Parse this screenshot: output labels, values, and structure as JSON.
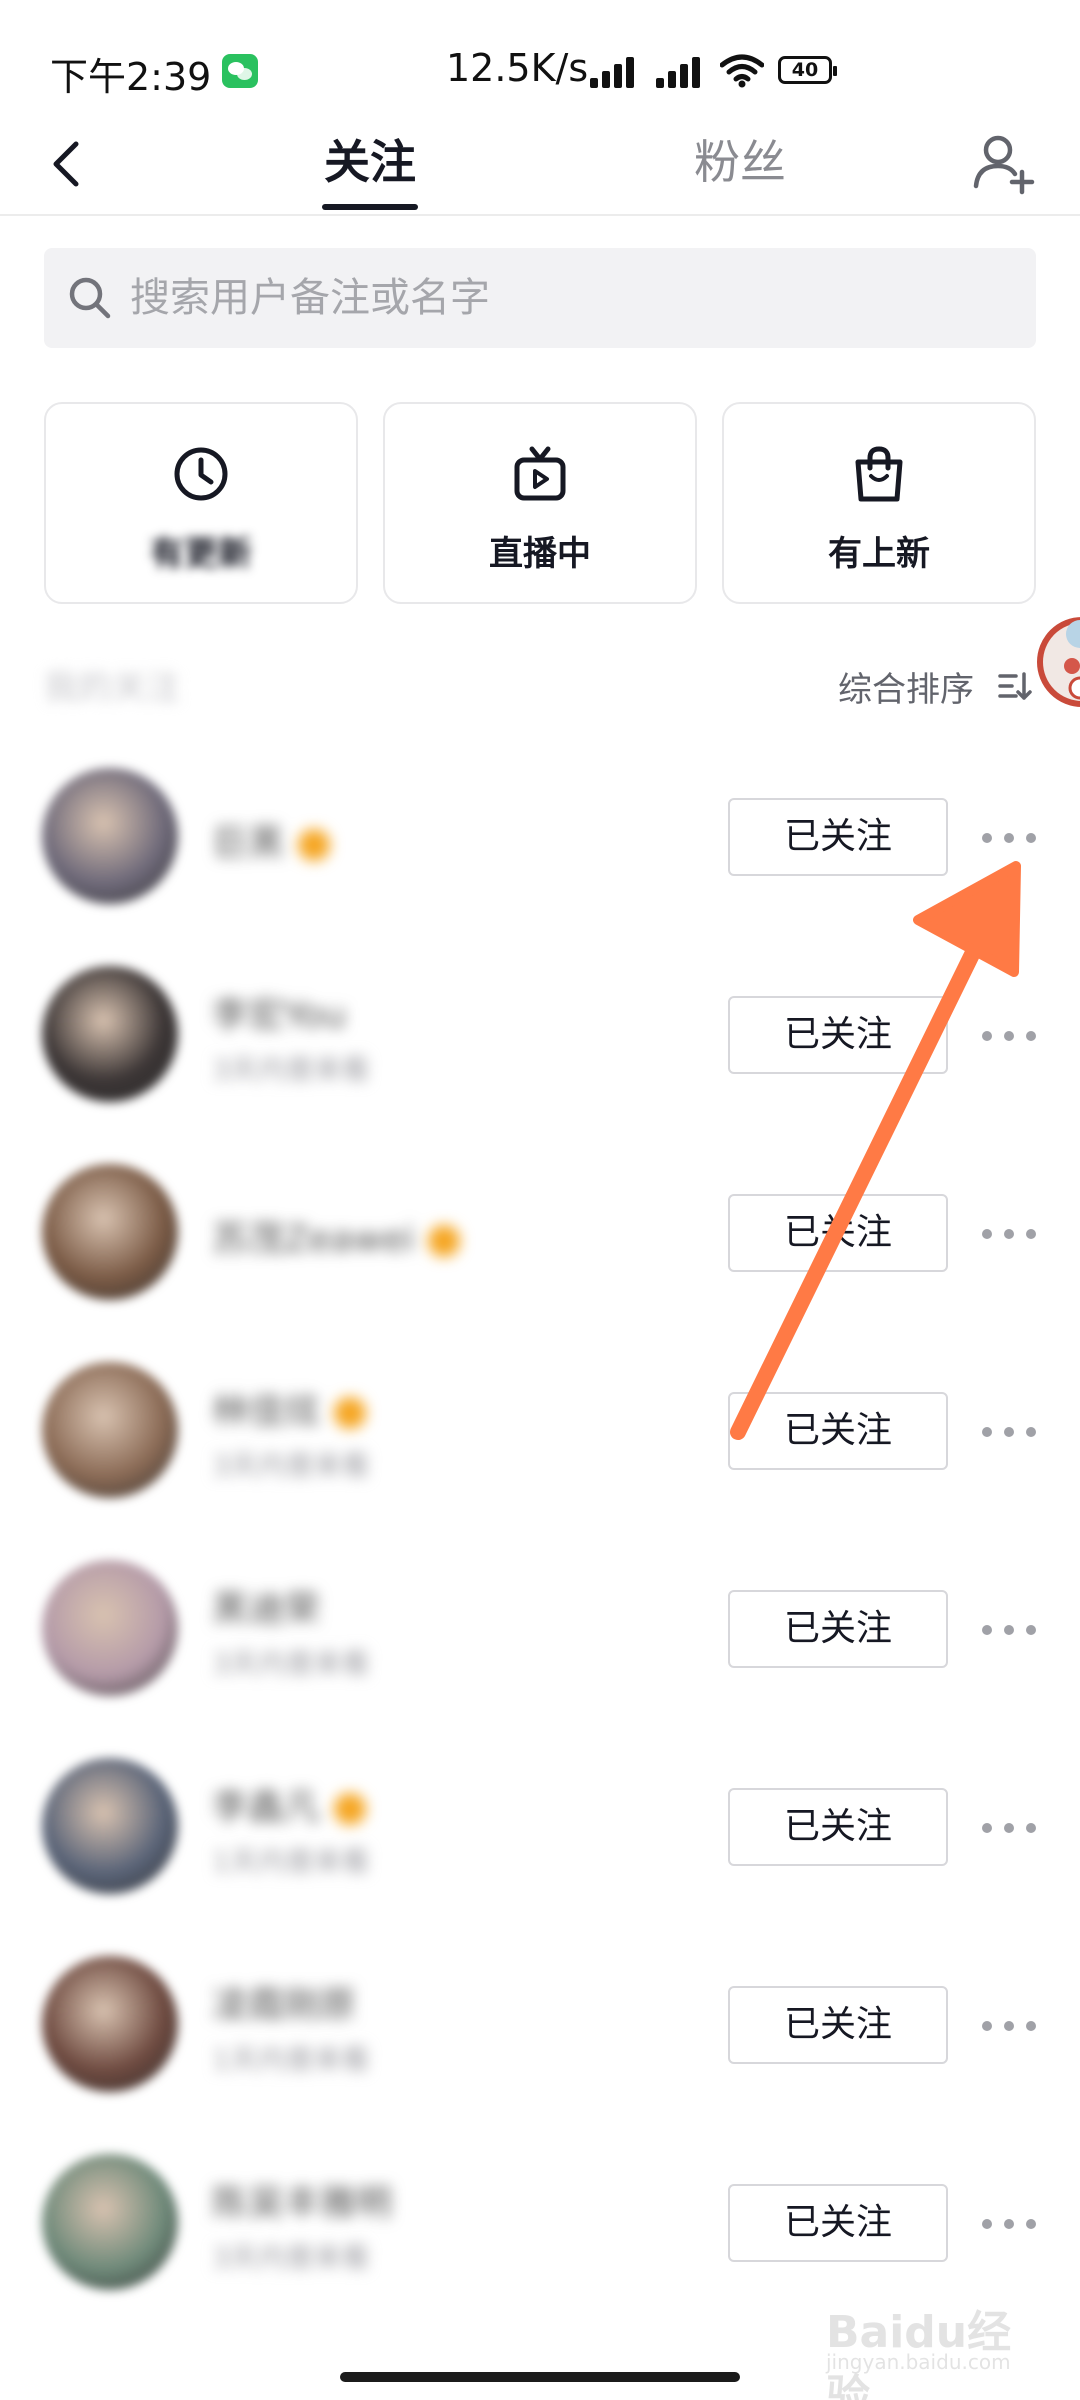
{
  "status_bar": {
    "time": "下午2:39",
    "network_speed": "12.5K/s",
    "battery": "40"
  },
  "nav": {
    "tab_following": "关注",
    "tab_fans": "粉丝"
  },
  "search": {
    "placeholder": "搜索用户备注或名字"
  },
  "filters": [
    {
      "label": "有更新",
      "icon": "clock-icon"
    },
    {
      "label": "直播中",
      "icon": "tv-play-icon"
    },
    {
      "label": "有上新",
      "icon": "shopping-bag-icon"
    }
  ],
  "section": {
    "title": "我的关注",
    "sort_label": "综合排序"
  },
  "follow_label": "已关注",
  "users": [
    {
      "name": "巨黑",
      "sub": "",
      "verified": true,
      "avatar_color": "#6f6a7a"
    },
    {
      "name": "李宏You",
      "sub": "3天内曾来看",
      "verified": false,
      "avatar_color": "#3b3535"
    },
    {
      "name": "苏茂Zeawei",
      "sub": "",
      "verified": true,
      "avatar_color": "#7a5a45"
    },
    {
      "name": "林佳炫",
      "sub": "3天内曾来看",
      "verified": true,
      "avatar_color": "#8a6a55"
    },
    {
      "name": "黑迪荣",
      "sub": "3天内曾来看",
      "verified": false,
      "avatar_color": "#b49aa8"
    },
    {
      "name": "李鑫凡",
      "sub": "1天内曾来看",
      "verified": true,
      "avatar_color": "#5a6478"
    },
    {
      "name": "凌霞刚原",
      "sub": "1天内曾来看",
      "verified": false,
      "avatar_color": "#6e4a40"
    },
    {
      "name": "陈吴丰雅明",
      "sub": "3天内曾来看",
      "verified": false,
      "avatar_color": "#6f8a7a"
    }
  ],
  "annotation_color": "#ff7a45",
  "watermark": {
    "main": "Baidu经验",
    "sub": "jingyan.baidu.com"
  }
}
